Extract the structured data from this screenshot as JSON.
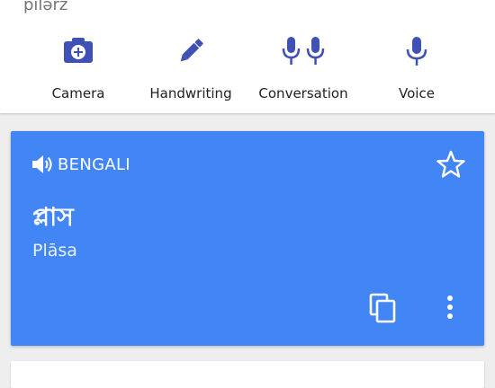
{
  "source": {
    "phonetic": "pilərz"
  },
  "input_options": [
    {
      "label": "Camera",
      "icon": "camera-icon"
    },
    {
      "label": "Handwriting",
      "icon": "pen-icon"
    },
    {
      "label": "Conversation",
      "icon": "two-microphones-icon"
    },
    {
      "label": "Voice",
      "icon": "microphone-icon"
    }
  ],
  "result": {
    "language": "BENGALI",
    "translation": "প্লাস",
    "transliteration": "Plāsa"
  },
  "colors": {
    "accent": "#3f51b5",
    "card": "#4285f4",
    "background": "#eeeeee"
  }
}
